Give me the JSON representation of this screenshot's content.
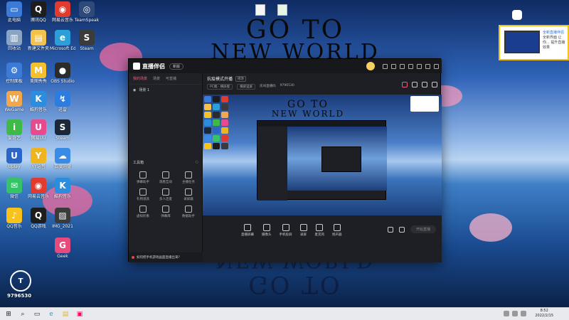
{
  "wallpaper": {
    "line1": "GO TO",
    "line2": "NEW WORLD"
  },
  "desktop_icons": [
    {
      "label": "此电脑",
      "color": "#3b7ad6",
      "glyph": "▭"
    },
    {
      "label": "腾讯QQ",
      "color": "#1d1d1d",
      "glyph": "Q"
    },
    {
      "label": "网易云音乐",
      "color": "#e03b2e",
      "glyph": "◉"
    },
    {
      "label": "TeamSpeak",
      "color": "#2e4a78",
      "glyph": "◎"
    },
    {
      "label": "回收站",
      "color": "#8aa4c4",
      "glyph": "▥"
    },
    {
      "label": "新建文件夹",
      "color": "#f2c14e",
      "glyph": "▤"
    },
    {
      "label": "Microsoft Edge",
      "color": "#2b9fd7",
      "glyph": "e"
    },
    {
      "label": "Steam",
      "color": "#3b3b3b",
      "glyph": "S"
    },
    {
      "label": "控制面板",
      "color": "#3b7ad6",
      "glyph": "⚙"
    },
    {
      "label": "美图秀秀",
      "color": "#f6c02c",
      "glyph": "M"
    },
    {
      "label": "OBS Studio",
      "color": "#2b2b2b",
      "glyph": "●"
    },
    {
      "label": "WeGame",
      "color": "#f2a84a",
      "glyph": "W"
    },
    {
      "label": "酷狗音乐",
      "color": "#2a8ee0",
      "glyph": "K"
    },
    {
      "label": "迅雷",
      "color": "#2d7de0",
      "glyph": "↯"
    },
    {
      "label": "爱奇艺",
      "color": "#3fb948",
      "glyph": "i"
    },
    {
      "label": "网易UU",
      "color": "#e84a8d",
      "glyph": "U"
    },
    {
      "label": "Steam",
      "color": "#1b2838",
      "glyph": "S"
    },
    {
      "label": "Uplay",
      "color": "#2a66c8",
      "glyph": "U"
    },
    {
      "label": "YY语音",
      "color": "#f0b41c",
      "glyph": "Y"
    },
    {
      "label": "百度网盘",
      "color": "#3a8be6",
      "glyph": "☁"
    },
    {
      "label": "微信",
      "color": "#36c267",
      "glyph": "✉"
    },
    {
      "label": "网易云音乐",
      "color": "#e03b2e",
      "glyph": "◉"
    },
    {
      "label": "酷狗音乐",
      "color": "#2a8ee0",
      "glyph": "K"
    },
    {
      "label": "QQ音乐",
      "color": "#f7c21c",
      "glyph": "♪"
    },
    {
      "label": "QQ游戏",
      "color": "#1d1d1d",
      "glyph": "Q"
    },
    {
      "label": "IMG_2021",
      "color": "#3a3a3a",
      "glyph": "▨"
    },
    {
      "label": "Geek",
      "color": "#e84a7d",
      "glyph": "G"
    }
  ],
  "app": {
    "name": "直播伴侣",
    "version": "新版",
    "left_tabs": [
      "我的场景",
      "场景",
      "可直播"
    ],
    "scene_name": "场景 1",
    "tools_heading": "工具箱",
    "tools": [
      {
        "label": "弹幕助手"
      },
      {
        "label": "观看互动"
      },
      {
        "label": "主播任务"
      },
      {
        "label": "礼物道具"
      },
      {
        "label": "多人连麦"
      },
      {
        "label": "录屏器"
      },
      {
        "label": "虚拟形象"
      },
      {
        "label": "弹幕库"
      },
      {
        "label": "数据助手"
      }
    ],
    "notice": "如何把手机游戏画面直播出来?",
    "stream_title": "抗疫模式开播",
    "stream_edit": "修改",
    "meta": [
      "PC端 · 横屏版",
      "横屏竖屏",
      "房间直播码",
      "9796530"
    ],
    "bottom_tools": [
      {
        "label": "直播屏幕"
      },
      {
        "label": "摄像头"
      },
      {
        "label": "手机投屏"
      },
      {
        "label": "录屏"
      },
      {
        "label": "麦克风"
      },
      {
        "label": "扬声器"
      }
    ],
    "start_button": "开始直播"
  },
  "toast": {
    "title": "全新直播伴侣",
    "body": "全新界面 让你... 提升直播效果"
  },
  "watermark": {
    "id": "9796530"
  },
  "taskbar": {
    "time": "8:52",
    "date": "2022/2/15"
  }
}
